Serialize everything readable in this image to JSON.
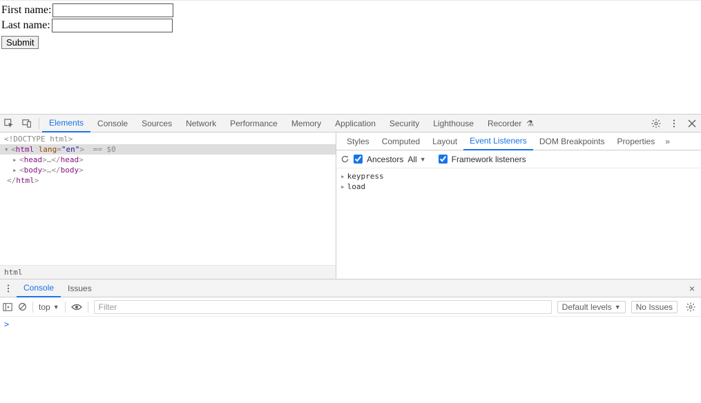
{
  "page": {
    "form": {
      "first_label": "First name:",
      "last_label": "Last name:",
      "submit_label": "Submit",
      "first_value": "",
      "last_value": ""
    }
  },
  "devtools": {
    "main_tabs": {
      "elements": "Elements",
      "console": "Console",
      "sources": "Sources",
      "network": "Network",
      "performance": "Performance",
      "memory": "Memory",
      "application": "Application",
      "security": "Security",
      "lighthouse": "Lighthouse",
      "recorder": "Recorder"
    },
    "dom": {
      "doctype": "<!DOCTYPE html>",
      "html_line_prefix": "<html ",
      "html_attr": "lang",
      "html_val": "\"en\"",
      "html_line_suffix": ">",
      "selected_marker": " == $0",
      "head_line": "<head>…</head>",
      "body_line": "<body>…</body>",
      "close_html": "</html>",
      "breadcrumb": "html"
    },
    "side_tabs": {
      "styles": "Styles",
      "computed": "Computed",
      "layout": "Layout",
      "event_listeners": "Event Listeners",
      "dom_breakpoints": "DOM Breakpoints",
      "properties": "Properties"
    },
    "listeners_toolbar": {
      "ancestors_label": "Ancestors",
      "scope": "All",
      "framework_label": "Framework listeners",
      "ancestors_checked": true,
      "framework_checked": true
    },
    "listeners": {
      "item1": "keypress",
      "item2": "load"
    },
    "drawer_tabs": {
      "console": "Console",
      "issues": "Issues"
    },
    "console_toolbar": {
      "context": "top",
      "filter_placeholder": "Filter",
      "levels": "Default levels",
      "issues": "No Issues"
    },
    "console_prompt": ">"
  }
}
